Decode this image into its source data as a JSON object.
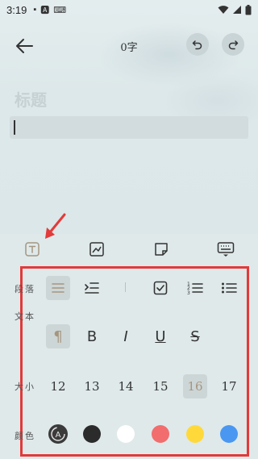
{
  "status_bar": {
    "time": "3:19",
    "icons": [
      "sim-icon",
      "text-icon",
      "keyboard-icon",
      "wifi-icon",
      "signal-icon",
      "battery-icon"
    ]
  },
  "header": {
    "word_count": "0字"
  },
  "editor": {
    "title_placeholder": "标题"
  },
  "format_tabs": [
    "text-format-icon",
    "image-icon",
    "sticky-note-icon",
    "keyboard-icon"
  ],
  "rows": {
    "paragraph": {
      "label": "段落"
    },
    "text": {
      "label": "文本",
      "bold": "B",
      "italic": "I",
      "underline": "U",
      "strike": "S"
    },
    "size": {
      "label": "大小",
      "sizes": [
        "12",
        "13",
        "14",
        "15",
        "16",
        "17"
      ],
      "selected": "16"
    },
    "color": {
      "label": "颜色",
      "swatches": [
        "#2b2b2b",
        "#ffffff",
        "#f26d6d",
        "#ffd93a",
        "#4a97f2"
      ]
    }
  },
  "colors": {
    "accent_highlight": "#e33a3a",
    "panel_bg": "#dfe9ea"
  }
}
